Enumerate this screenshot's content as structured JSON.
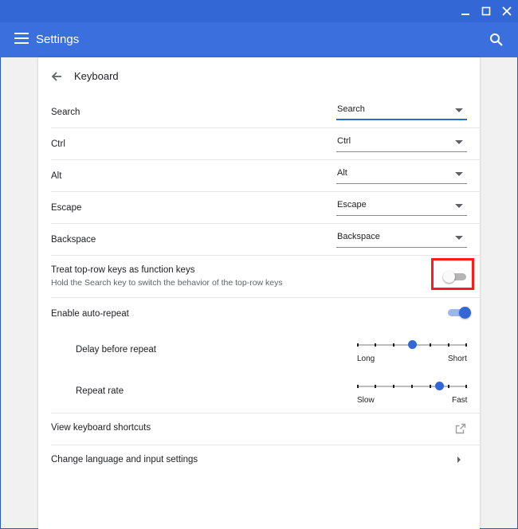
{
  "app": {
    "title": "Settings"
  },
  "page": {
    "title": "Keyboard"
  },
  "key_remaps": [
    {
      "label": "Search",
      "value": "Search"
    },
    {
      "label": "Ctrl",
      "value": "Ctrl"
    },
    {
      "label": "Alt",
      "value": "Alt"
    },
    {
      "label": "Escape",
      "value": "Escape"
    },
    {
      "label": "Backspace",
      "value": "Backspace"
    }
  ],
  "function_keys": {
    "label": "Treat top-row keys as function keys",
    "sublabel": "Hold the Search key to switch the behavior of the top-row keys",
    "enabled": false
  },
  "auto_repeat": {
    "label": "Enable auto-repeat",
    "enabled": true,
    "delay": {
      "label": "Delay before repeat",
      "min_label": "Long",
      "max_label": "Short",
      "value_fraction": 0.5
    },
    "rate": {
      "label": "Repeat rate",
      "min_label": "Slow",
      "max_label": "Fast",
      "value_fraction": 0.75
    }
  },
  "links": {
    "shortcuts": "View keyboard shortcuts",
    "language": "Change language and input settings"
  },
  "icons": [
    "minimize-icon",
    "maximize-icon",
    "close-icon",
    "menu-icon",
    "search-icon",
    "back-arrow-icon",
    "external-link-icon",
    "chevron-right-icon"
  ],
  "colors": {
    "accent": "#3367d6",
    "highlight": "#ff1a1a"
  }
}
